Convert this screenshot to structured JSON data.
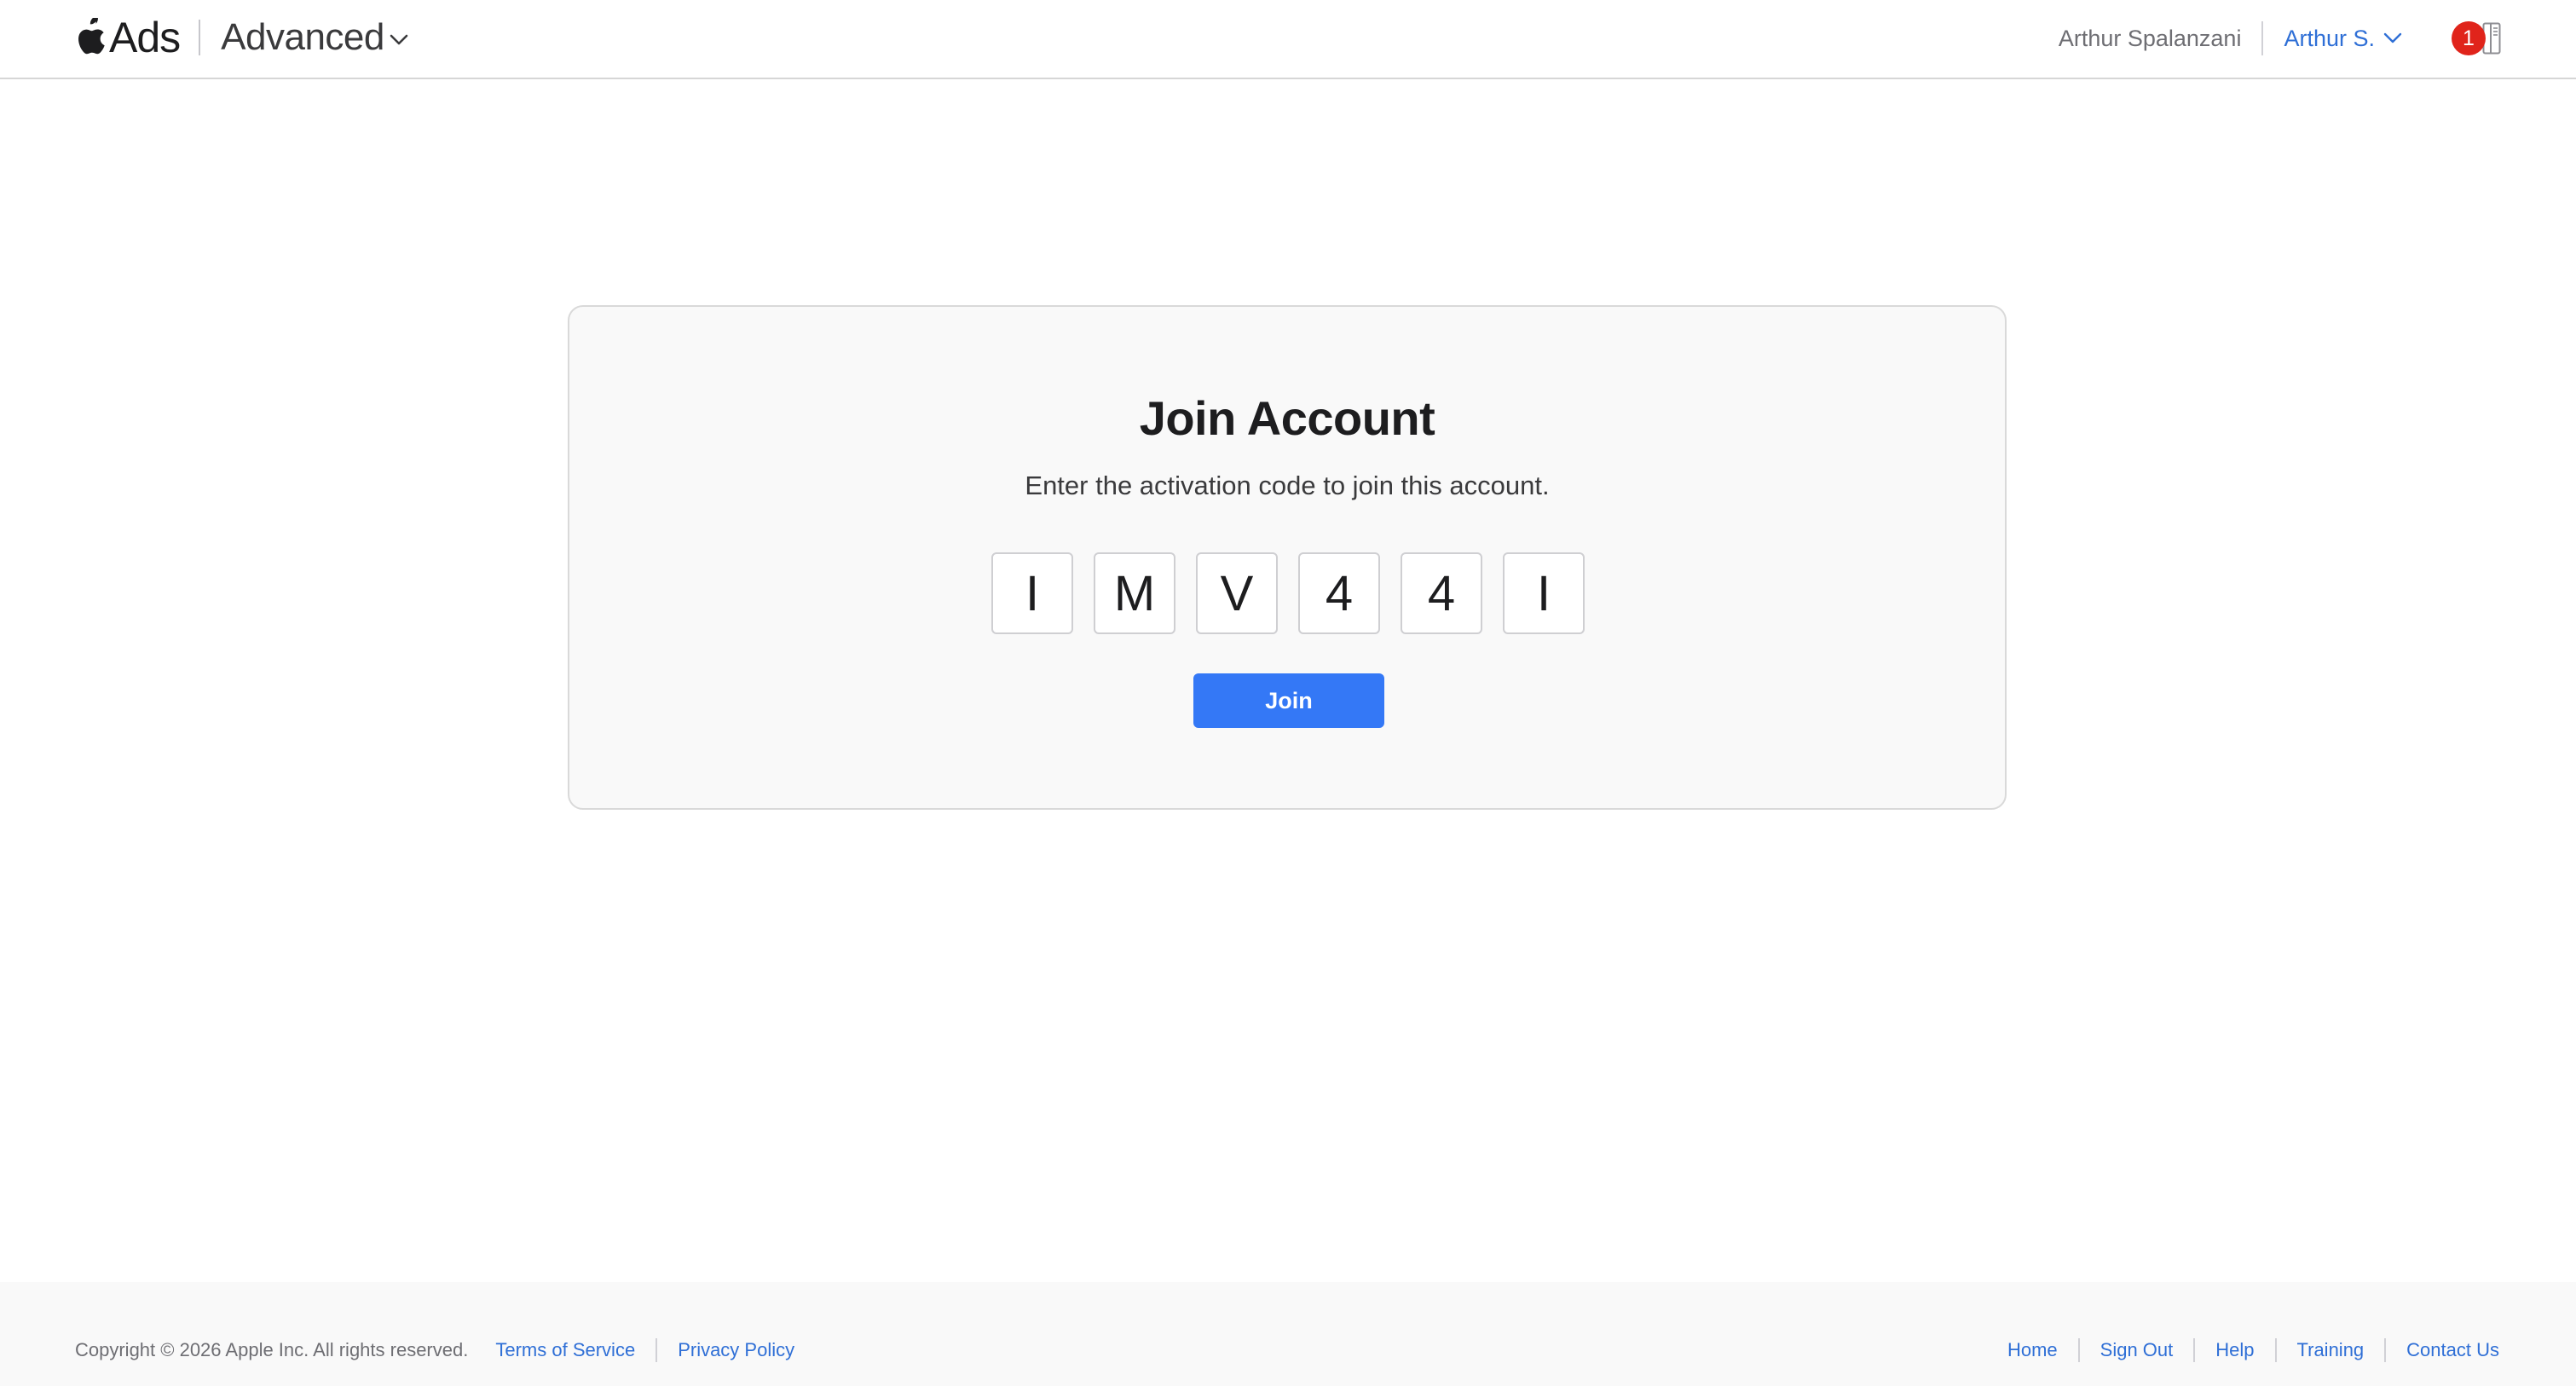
{
  "header": {
    "brand": "Ads",
    "product": "Advanced",
    "user_full_name": "Arthur Spalanzani",
    "account_label": "Arthur S.",
    "notification_count": "1"
  },
  "card": {
    "title": "Join Account",
    "subtitle": "Enter the activation code to join this account.",
    "code": [
      "I",
      "M",
      "V",
      "4",
      "4",
      "I"
    ],
    "join_label": "Join"
  },
  "footer": {
    "copyright": "Copyright © 2026 Apple Inc. All rights reserved.",
    "left_links": [
      "Terms of Service",
      "Privacy Policy"
    ],
    "right_links": [
      "Home",
      "Sign Out",
      "Help",
      "Training",
      "Contact Us"
    ]
  },
  "colors": {
    "accent": "#3478f6",
    "link": "#2f6fd6",
    "badge": "#e0241b"
  },
  "icons": {
    "logo": "apple-logo-icon",
    "product_menu": "chevron-down-icon",
    "account_menu": "chevron-down-icon",
    "panel": "sidebar-panel-icon"
  }
}
